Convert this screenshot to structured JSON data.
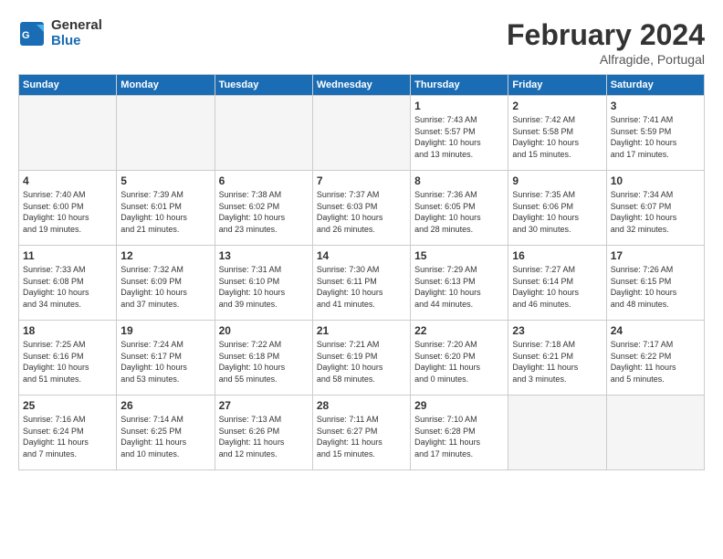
{
  "header": {
    "logo_general": "General",
    "logo_blue": "Blue",
    "month_title": "February 2024",
    "location": "Alfragide, Portugal"
  },
  "days_of_week": [
    "Sunday",
    "Monday",
    "Tuesday",
    "Wednesday",
    "Thursday",
    "Friday",
    "Saturday"
  ],
  "weeks": [
    [
      {
        "num": "",
        "info": ""
      },
      {
        "num": "",
        "info": ""
      },
      {
        "num": "",
        "info": ""
      },
      {
        "num": "",
        "info": ""
      },
      {
        "num": "1",
        "info": "Sunrise: 7:43 AM\nSunset: 5:57 PM\nDaylight: 10 hours\nand 13 minutes."
      },
      {
        "num": "2",
        "info": "Sunrise: 7:42 AM\nSunset: 5:58 PM\nDaylight: 10 hours\nand 15 minutes."
      },
      {
        "num": "3",
        "info": "Sunrise: 7:41 AM\nSunset: 5:59 PM\nDaylight: 10 hours\nand 17 minutes."
      }
    ],
    [
      {
        "num": "4",
        "info": "Sunrise: 7:40 AM\nSunset: 6:00 PM\nDaylight: 10 hours\nand 19 minutes."
      },
      {
        "num": "5",
        "info": "Sunrise: 7:39 AM\nSunset: 6:01 PM\nDaylight: 10 hours\nand 21 minutes."
      },
      {
        "num": "6",
        "info": "Sunrise: 7:38 AM\nSunset: 6:02 PM\nDaylight: 10 hours\nand 23 minutes."
      },
      {
        "num": "7",
        "info": "Sunrise: 7:37 AM\nSunset: 6:03 PM\nDaylight: 10 hours\nand 26 minutes."
      },
      {
        "num": "8",
        "info": "Sunrise: 7:36 AM\nSunset: 6:05 PM\nDaylight: 10 hours\nand 28 minutes."
      },
      {
        "num": "9",
        "info": "Sunrise: 7:35 AM\nSunset: 6:06 PM\nDaylight: 10 hours\nand 30 minutes."
      },
      {
        "num": "10",
        "info": "Sunrise: 7:34 AM\nSunset: 6:07 PM\nDaylight: 10 hours\nand 32 minutes."
      }
    ],
    [
      {
        "num": "11",
        "info": "Sunrise: 7:33 AM\nSunset: 6:08 PM\nDaylight: 10 hours\nand 34 minutes."
      },
      {
        "num": "12",
        "info": "Sunrise: 7:32 AM\nSunset: 6:09 PM\nDaylight: 10 hours\nand 37 minutes."
      },
      {
        "num": "13",
        "info": "Sunrise: 7:31 AM\nSunset: 6:10 PM\nDaylight: 10 hours\nand 39 minutes."
      },
      {
        "num": "14",
        "info": "Sunrise: 7:30 AM\nSunset: 6:11 PM\nDaylight: 10 hours\nand 41 minutes."
      },
      {
        "num": "15",
        "info": "Sunrise: 7:29 AM\nSunset: 6:13 PM\nDaylight: 10 hours\nand 44 minutes."
      },
      {
        "num": "16",
        "info": "Sunrise: 7:27 AM\nSunset: 6:14 PM\nDaylight: 10 hours\nand 46 minutes."
      },
      {
        "num": "17",
        "info": "Sunrise: 7:26 AM\nSunset: 6:15 PM\nDaylight: 10 hours\nand 48 minutes."
      }
    ],
    [
      {
        "num": "18",
        "info": "Sunrise: 7:25 AM\nSunset: 6:16 PM\nDaylight: 10 hours\nand 51 minutes."
      },
      {
        "num": "19",
        "info": "Sunrise: 7:24 AM\nSunset: 6:17 PM\nDaylight: 10 hours\nand 53 minutes."
      },
      {
        "num": "20",
        "info": "Sunrise: 7:22 AM\nSunset: 6:18 PM\nDaylight: 10 hours\nand 55 minutes."
      },
      {
        "num": "21",
        "info": "Sunrise: 7:21 AM\nSunset: 6:19 PM\nDaylight: 10 hours\nand 58 minutes."
      },
      {
        "num": "22",
        "info": "Sunrise: 7:20 AM\nSunset: 6:20 PM\nDaylight: 11 hours\nand 0 minutes."
      },
      {
        "num": "23",
        "info": "Sunrise: 7:18 AM\nSunset: 6:21 PM\nDaylight: 11 hours\nand 3 minutes."
      },
      {
        "num": "24",
        "info": "Sunrise: 7:17 AM\nSunset: 6:22 PM\nDaylight: 11 hours\nand 5 minutes."
      }
    ],
    [
      {
        "num": "25",
        "info": "Sunrise: 7:16 AM\nSunset: 6:24 PM\nDaylight: 11 hours\nand 7 minutes."
      },
      {
        "num": "26",
        "info": "Sunrise: 7:14 AM\nSunset: 6:25 PM\nDaylight: 11 hours\nand 10 minutes."
      },
      {
        "num": "27",
        "info": "Sunrise: 7:13 AM\nSunset: 6:26 PM\nDaylight: 11 hours\nand 12 minutes."
      },
      {
        "num": "28",
        "info": "Sunrise: 7:11 AM\nSunset: 6:27 PM\nDaylight: 11 hours\nand 15 minutes."
      },
      {
        "num": "29",
        "info": "Sunrise: 7:10 AM\nSunset: 6:28 PM\nDaylight: 11 hours\nand 17 minutes."
      },
      {
        "num": "",
        "info": ""
      },
      {
        "num": "",
        "info": ""
      }
    ]
  ]
}
